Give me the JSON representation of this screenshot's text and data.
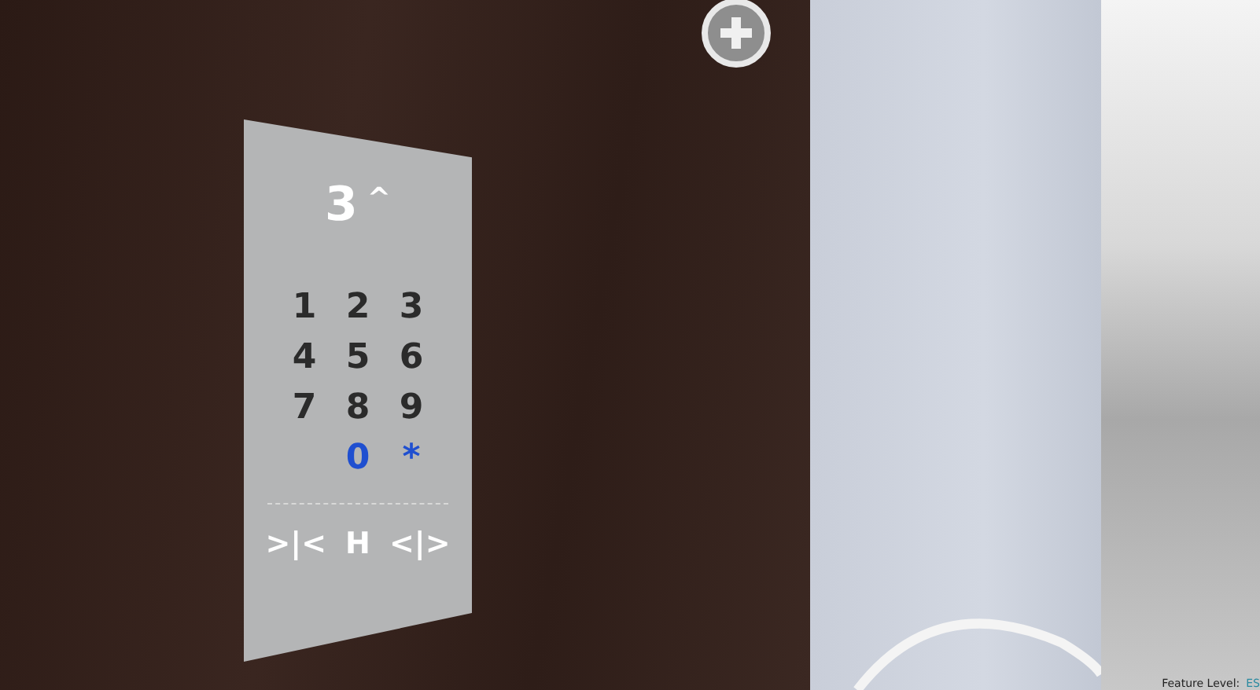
{
  "floor_display": {
    "number": "3",
    "direction": "^"
  },
  "keys": [
    {
      "label": "1",
      "lit": false
    },
    {
      "label": "2",
      "lit": false
    },
    {
      "label": "3",
      "lit": false
    },
    {
      "label": "4",
      "lit": false
    },
    {
      "label": "5",
      "lit": false
    },
    {
      "label": "6",
      "lit": false
    },
    {
      "label": "7",
      "lit": false
    },
    {
      "label": "8",
      "lit": false
    },
    {
      "label": "9",
      "lit": false
    },
    {
      "label": "0",
      "lit": true
    },
    {
      "label": "*",
      "lit": true
    }
  ],
  "door_buttons": [
    ">|<",
    "H",
    "<|>"
  ],
  "status": {
    "label": "Feature Level:",
    "value": "ES"
  }
}
